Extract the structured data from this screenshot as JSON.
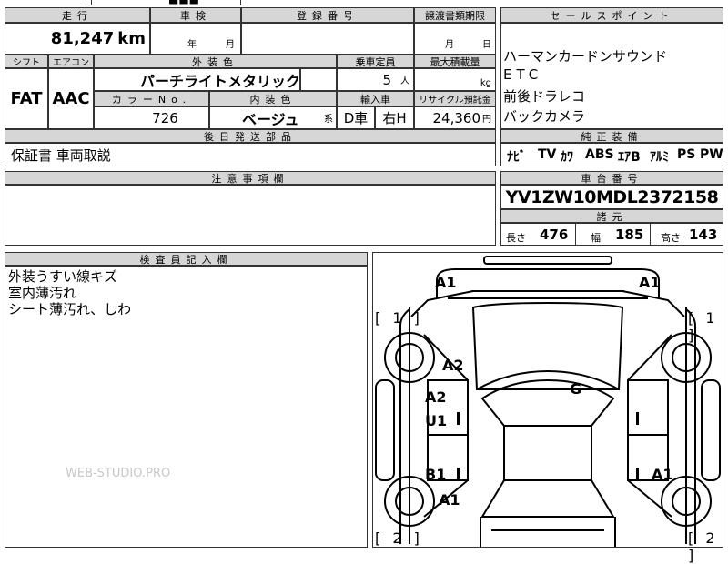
{
  "top_strip": {
    "partial_text": "■■■"
  },
  "mileage": {
    "header": "走行",
    "value": "81,247",
    "unit": "km"
  },
  "shaken": {
    "header": "車検",
    "year_unit": "年",
    "month_unit": "月"
  },
  "registration": {
    "header": "登録番号",
    "value": ""
  },
  "transfer_deadline": {
    "header": "譲渡書類期限",
    "month_unit": "月",
    "day_unit": "日"
  },
  "shift": {
    "header": "シフト",
    "value": "FAT"
  },
  "aircon": {
    "header": "エアコン",
    "value": "AAC"
  },
  "exterior_color": {
    "header": "外装色",
    "value": "パーチライトメタリック"
  },
  "capacity": {
    "header": "乗車定員",
    "value": "5",
    "unit": "人"
  },
  "max_load": {
    "header": "最大積載量",
    "value": "",
    "unit": "kg"
  },
  "color_no": {
    "header": "カラーNo.",
    "value": "726"
  },
  "interior_color": {
    "header": "内装色",
    "value": "ベージュ",
    "suffix": "系"
  },
  "import": {
    "header": "輸入車",
    "value1": "D車",
    "value2": "右H"
  },
  "recycle": {
    "header": "リサイクル預託金",
    "value": "24,360",
    "unit": "円"
  },
  "later_parts": {
    "header": "後日発送部品",
    "value": "保証書 車両取説"
  },
  "sales_points": {
    "header": "セールスポイント",
    "items": [
      "ハーマンカードンサウンド",
      "ETC",
      "前後ドラレコ",
      "バックカメラ"
    ]
  },
  "standard_equipment": {
    "header": "純正装備",
    "items": [
      "ﾅﾋﾞ",
      "TV",
      "ｶﾜ",
      "ABS",
      "ｴｱB",
      "ｱﾙﾐ",
      "PS",
      "PW"
    ]
  },
  "caution": {
    "header": "注意事項欄",
    "value": ""
  },
  "chassis": {
    "header": "車台番号",
    "value": "YV1ZW10MDL2372158"
  },
  "dimensions": {
    "header": "諸元",
    "length_label": "長さ",
    "length": "476",
    "width_label": "幅",
    "width": "185",
    "height_label": "高さ",
    "height": "143"
  },
  "inspector": {
    "header": "検査員記入欄",
    "lines": [
      "外装うすい線キズ",
      "室内薄汚れ",
      "シート薄汚れ、しわ"
    ]
  },
  "watermark": "WEB-STUDIO.PRO",
  "diagram": {
    "labels": {
      "a1_top_left": "A1",
      "a1_top_right": "A1",
      "a2_hood": "A2",
      "g_windshield": "G",
      "a2_front_door": "A2",
      "u1_front_door": "U1",
      "b1_rear_door": "B1",
      "a1_rear_left": "A1",
      "a1_rear_right": "A1"
    },
    "brackets": {
      "front_left": "[ 1 ]",
      "front_right": "[ 1 ]",
      "rear_left": "[ 2 ]",
      "rear_right": "[ 2 ]"
    }
  }
}
